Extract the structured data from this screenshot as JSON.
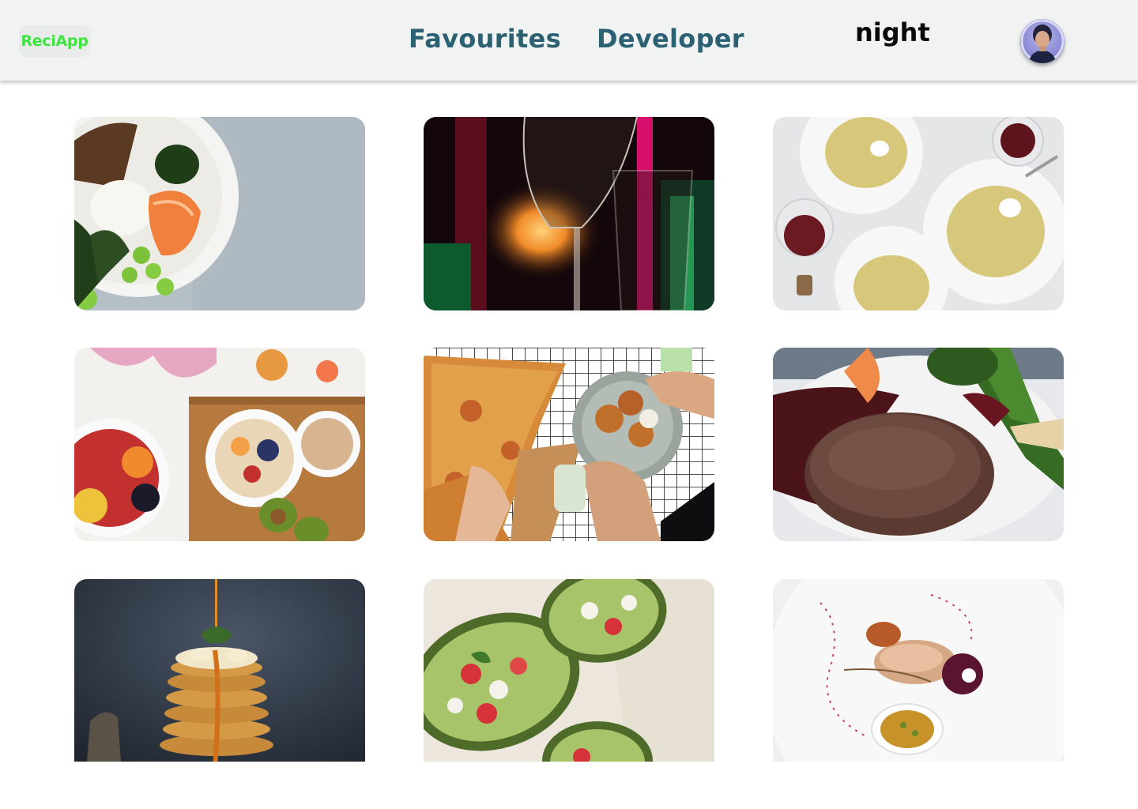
{
  "navbar": {
    "logo": "ReciApp",
    "links": [
      "Favourites",
      "Developer"
    ],
    "theme_toggle": "night",
    "avatar_icon": "user-avatar"
  },
  "recipes": [
    {
      "image": "poke-bowl-photo"
    },
    {
      "image": "wine-glass-photo"
    },
    {
      "image": "pasta-dinner-photo"
    },
    {
      "image": "breakfast-spread-photo"
    },
    {
      "image": "pizza-wings-photo"
    },
    {
      "image": "steak-photo"
    },
    {
      "image": "pancake-stack-photo"
    },
    {
      "image": "stuffed-avocado-photo"
    },
    {
      "image": "plated-fish-photo"
    }
  ],
  "colors": {
    "logo_text": "#3ee43e",
    "nav_link": "#2b6172",
    "navbar_bg": "#f1f3f2"
  }
}
